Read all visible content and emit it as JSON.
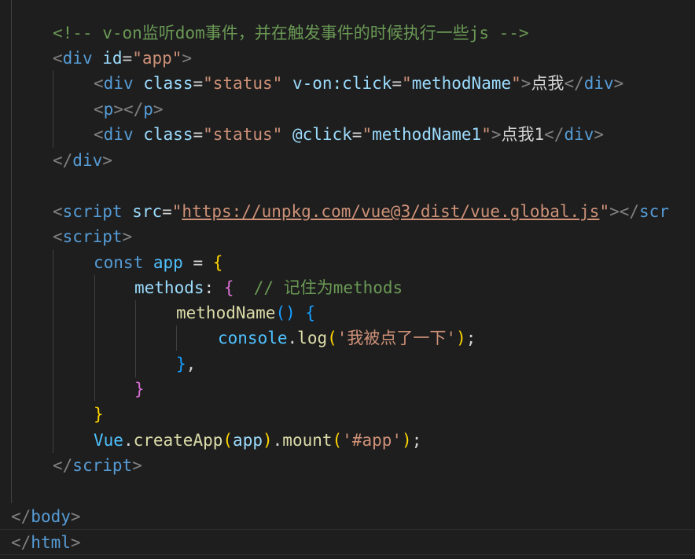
{
  "lines": [
    {
      "id": "l1",
      "tokens": [
        {
          "c": "comment",
          "t": "<!-- v-on监听dom事件，并在触发事件的时候执行一些js -->"
        }
      ]
    },
    {
      "id": "l2",
      "tokens": [
        {
          "c": "bracket",
          "t": "<"
        },
        {
          "c": "tag",
          "t": "div"
        },
        {
          "c": "text",
          "t": " "
        },
        {
          "c": "attr",
          "t": "id"
        },
        {
          "c": "text",
          "t": "="
        },
        {
          "c": "str",
          "t": "\"app\""
        },
        {
          "c": "bracket",
          "t": ">"
        }
      ]
    },
    {
      "id": "l3",
      "tokens": [
        {
          "c": "bracket",
          "t": "<"
        },
        {
          "c": "tag",
          "t": "div"
        },
        {
          "c": "text",
          "t": " "
        },
        {
          "c": "attr",
          "t": "class"
        },
        {
          "c": "text",
          "t": "="
        },
        {
          "c": "str",
          "t": "\"status\""
        },
        {
          "c": "text",
          "t": " "
        },
        {
          "c": "attr",
          "t": "v-on:click"
        },
        {
          "c": "text",
          "t": "="
        },
        {
          "c": "str",
          "t": "\""
        },
        {
          "c": "attr",
          "t": "methodName"
        },
        {
          "c": "str",
          "t": "\""
        },
        {
          "c": "bracket",
          "t": ">"
        },
        {
          "c": "text",
          "t": "点我"
        },
        {
          "c": "bracket",
          "t": "</"
        },
        {
          "c": "tag",
          "t": "div"
        },
        {
          "c": "bracket",
          "t": ">"
        }
      ]
    },
    {
      "id": "l4",
      "tokens": [
        {
          "c": "bracket",
          "t": "<"
        },
        {
          "c": "tag",
          "t": "p"
        },
        {
          "c": "bracket",
          "t": "></"
        },
        {
          "c": "tag",
          "t": "p"
        },
        {
          "c": "bracket",
          "t": ">"
        }
      ]
    },
    {
      "id": "l5",
      "tokens": [
        {
          "c": "bracket",
          "t": "<"
        },
        {
          "c": "tag",
          "t": "div"
        },
        {
          "c": "text",
          "t": " "
        },
        {
          "c": "attr",
          "t": "class"
        },
        {
          "c": "text",
          "t": "="
        },
        {
          "c": "str",
          "t": "\"status\""
        },
        {
          "c": "text",
          "t": " "
        },
        {
          "c": "attr",
          "t": "@click"
        },
        {
          "c": "text",
          "t": "="
        },
        {
          "c": "str",
          "t": "\""
        },
        {
          "c": "attr",
          "t": "methodName1"
        },
        {
          "c": "str",
          "t": "\""
        },
        {
          "c": "bracket",
          "t": ">"
        },
        {
          "c": "text",
          "t": "点我1"
        },
        {
          "c": "bracket",
          "t": "</"
        },
        {
          "c": "tag",
          "t": "div"
        },
        {
          "c": "bracket",
          "t": ">"
        }
      ]
    },
    {
      "id": "l6",
      "tokens": [
        {
          "c": "bracket",
          "t": "</"
        },
        {
          "c": "tag",
          "t": "div"
        },
        {
          "c": "bracket",
          "t": ">"
        }
      ]
    },
    {
      "id": "l7",
      "tokens": []
    },
    {
      "id": "l8",
      "tokens": [
        {
          "c": "bracket",
          "t": "<"
        },
        {
          "c": "tag",
          "t": "script"
        },
        {
          "c": "text",
          "t": " "
        },
        {
          "c": "attr",
          "t": "src"
        },
        {
          "c": "text",
          "t": "="
        },
        {
          "c": "str",
          "t": "\""
        },
        {
          "c": "str link",
          "t": "https://unpkg.com/vue@3/dist/vue.global.js"
        },
        {
          "c": "str",
          "t": "\""
        },
        {
          "c": "bracket",
          "t": "></"
        },
        {
          "c": "tag",
          "t": "scr"
        }
      ]
    },
    {
      "id": "l9",
      "tokens": [
        {
          "c": "bracket",
          "t": "<"
        },
        {
          "c": "tag",
          "t": "script"
        },
        {
          "c": "bracket",
          "t": ">"
        }
      ]
    },
    {
      "id": "l10",
      "tokens": [
        {
          "c": "kw",
          "t": "const"
        },
        {
          "c": "text",
          "t": " "
        },
        {
          "c": "var",
          "t": "app"
        },
        {
          "c": "text",
          "t": " = "
        },
        {
          "c": "b1",
          "t": "{"
        }
      ]
    },
    {
      "id": "l11",
      "tokens": [
        {
          "c": "prop",
          "t": "methods"
        },
        {
          "c": "text",
          "t": ": "
        },
        {
          "c": "b2",
          "t": "{"
        },
        {
          "c": "text",
          "t": "  "
        },
        {
          "c": "comment",
          "t": "// 记住为methods"
        }
      ]
    },
    {
      "id": "l12",
      "tokens": [
        {
          "c": "fn",
          "t": "methodName"
        },
        {
          "c": "b3",
          "t": "()"
        },
        {
          "c": "text",
          "t": " "
        },
        {
          "c": "b3",
          "t": "{"
        }
      ]
    },
    {
      "id": "l13",
      "tokens": [
        {
          "c": "var",
          "t": "console"
        },
        {
          "c": "text",
          "t": "."
        },
        {
          "c": "fn",
          "t": "log"
        },
        {
          "c": "b1",
          "t": "("
        },
        {
          "c": "str",
          "t": "'我被点了一下'"
        },
        {
          "c": "b1",
          "t": ")"
        },
        {
          "c": "text",
          "t": ";"
        }
      ]
    },
    {
      "id": "l14",
      "tokens": [
        {
          "c": "b3",
          "t": "}"
        },
        {
          "c": "text",
          "t": ","
        }
      ]
    },
    {
      "id": "l15",
      "tokens": [
        {
          "c": "b2",
          "t": "}"
        }
      ]
    },
    {
      "id": "l16",
      "tokens": [
        {
          "c": "b1",
          "t": "}"
        }
      ]
    },
    {
      "id": "l17",
      "tokens": [
        {
          "c": "var",
          "t": "Vue"
        },
        {
          "c": "text",
          "t": "."
        },
        {
          "c": "fn",
          "t": "createApp"
        },
        {
          "c": "b1",
          "t": "("
        },
        {
          "c": "prop",
          "t": "app"
        },
        {
          "c": "b1",
          "t": ")"
        },
        {
          "c": "text",
          "t": "."
        },
        {
          "c": "fn",
          "t": "mount"
        },
        {
          "c": "b1",
          "t": "("
        },
        {
          "c": "str",
          "t": "'#app'"
        },
        {
          "c": "b1",
          "t": ")"
        },
        {
          "c": "text",
          "t": ";"
        }
      ]
    },
    {
      "id": "l18",
      "tokens": [
        {
          "c": "bracket",
          "t": "</"
        },
        {
          "c": "tag",
          "t": "script"
        },
        {
          "c": "bracket",
          "t": ">"
        }
      ]
    },
    {
      "id": "l19",
      "tokens": []
    },
    {
      "id": "l20",
      "tokens": [
        {
          "c": "bracket",
          "t": "</"
        },
        {
          "c": "tag",
          "t": "body"
        },
        {
          "c": "bracket",
          "t": ">"
        }
      ]
    },
    {
      "id": "l21",
      "tokens": [
        {
          "c": "bracket",
          "t": "</"
        },
        {
          "c": "tag",
          "t": "html"
        },
        {
          "c": "bracket",
          "t": ">"
        }
      ]
    }
  ]
}
